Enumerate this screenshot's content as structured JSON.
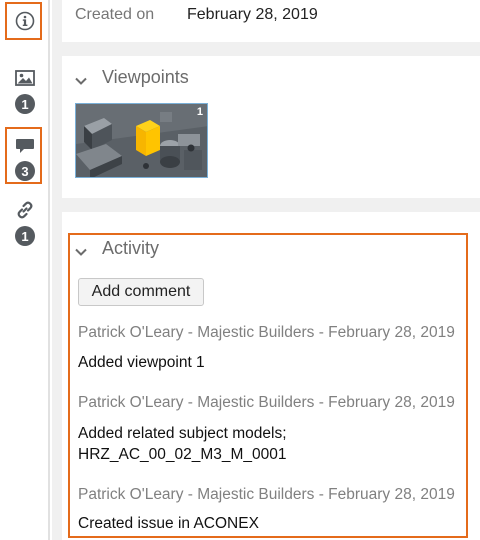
{
  "rail": {
    "info_icon": "info-circle-icon",
    "viewpoints_icon": "image-icon",
    "viewpoints_count": "1",
    "comments_icon": "comment-icon",
    "comments_count": "3",
    "links_icon": "link-icon",
    "links_count": "1"
  },
  "details": {
    "created_label": "Created on",
    "created_value": "February 28, 2019"
  },
  "viewpoints": {
    "title": "Viewpoints",
    "items": [
      {
        "number": "1"
      }
    ]
  },
  "activity": {
    "title": "Activity",
    "add_comment_label": "Add comment",
    "entries": [
      {
        "meta": "Patrick O'Leary - Majestic Builders - February 28, 2019",
        "lines": [
          "Added viewpoint 1"
        ]
      },
      {
        "meta": "Patrick O'Leary - Majestic Builders - February 28, 2019",
        "lines": [
          "Added related subject models;",
          "HRZ_AC_00_02_M3_M_0001"
        ]
      },
      {
        "meta": "Patrick O'Leary - Majestic Builders - February 28, 2019",
        "lines": [
          "Created issue in ACONEX"
        ]
      }
    ]
  },
  "colors": {
    "highlight": "#e46b1b",
    "badge": "#555a5f",
    "panel_bg": "#f0f0f0"
  }
}
